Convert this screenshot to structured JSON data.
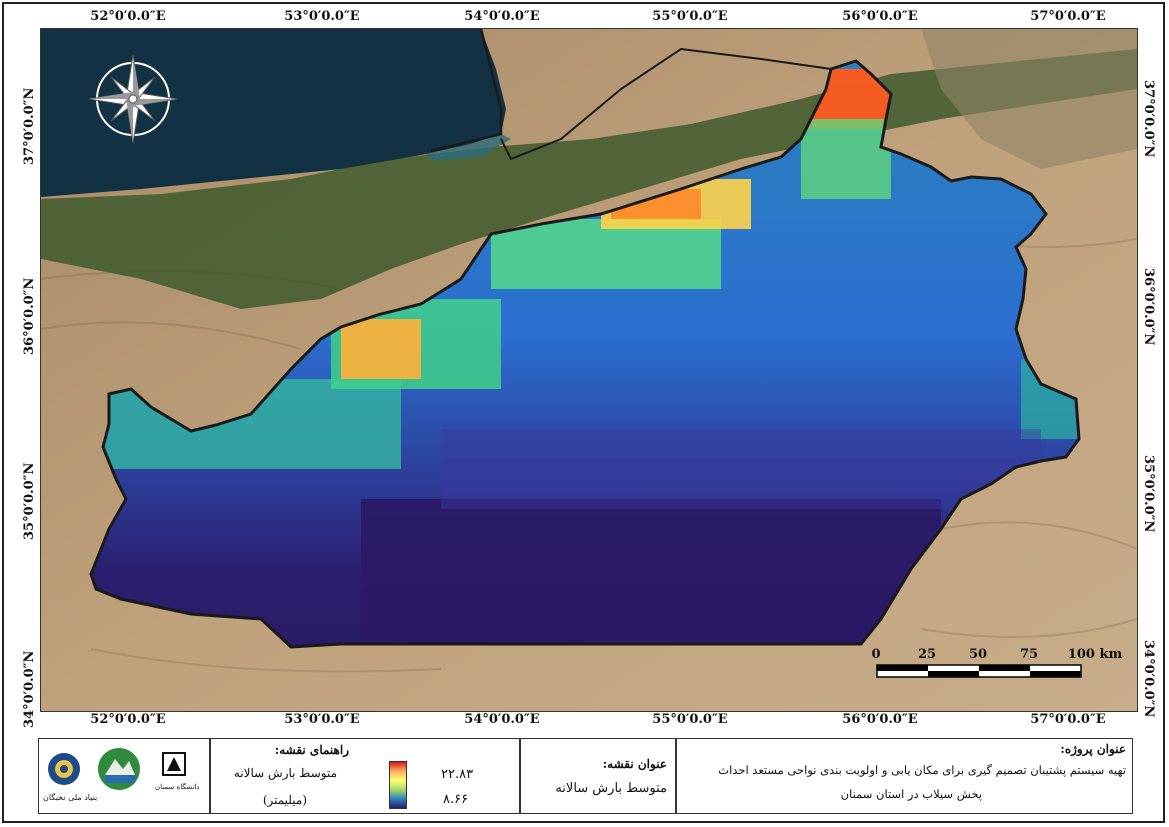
{
  "map": {
    "lon_labels": [
      "52°0′0.0″E",
      "53°0′0.0″E",
      "54°0′0.0″E",
      "55°0′0.0″E",
      "56°0′0.0″E",
      "57°0′0.0″E"
    ],
    "lat_labels": [
      "37°0′0.0″N",
      "36°0′0.0″N",
      "35°0′0.0″N",
      "34°0′0.0″N"
    ],
    "scalebar": {
      "labels": [
        "0",
        "25",
        "50",
        "75",
        "100 km"
      ]
    },
    "north_arrow_icon": "compass-rose-icon",
    "colors": {
      "sea": "#113040",
      "land": "#b89a73",
      "forest": "#3c5a2c",
      "boundary": "#1a1a1a"
    }
  },
  "legend": {
    "title": "راهنمای نقشه:",
    "item_label": "متوسط بارش سالانه",
    "unit": "(میلیمتر)",
    "max": "۲۲.۸۳",
    "min": "۸.۶۶",
    "ramp": [
      "#d7191c",
      "#fdae61",
      "#ffff73",
      "#a6d96a",
      "#2b83ba",
      "#2c1a6e"
    ]
  },
  "map_title": {
    "label": "عنوان نقشه:",
    "value": "متوسط بارش سالانه"
  },
  "project": {
    "label": "عنوان پروژه:",
    "line1": "تهیه سیستم پشتیبان تصمیم گیری برای مکان یابی و اولویت بندی نواحی مستعد احداث",
    "line2": "پخش سیلاب در استان سمنان"
  },
  "logos": {
    "nokhbegan": "بنیاد ملی نخبگان",
    "university": "دانشگاه سمنان"
  }
}
